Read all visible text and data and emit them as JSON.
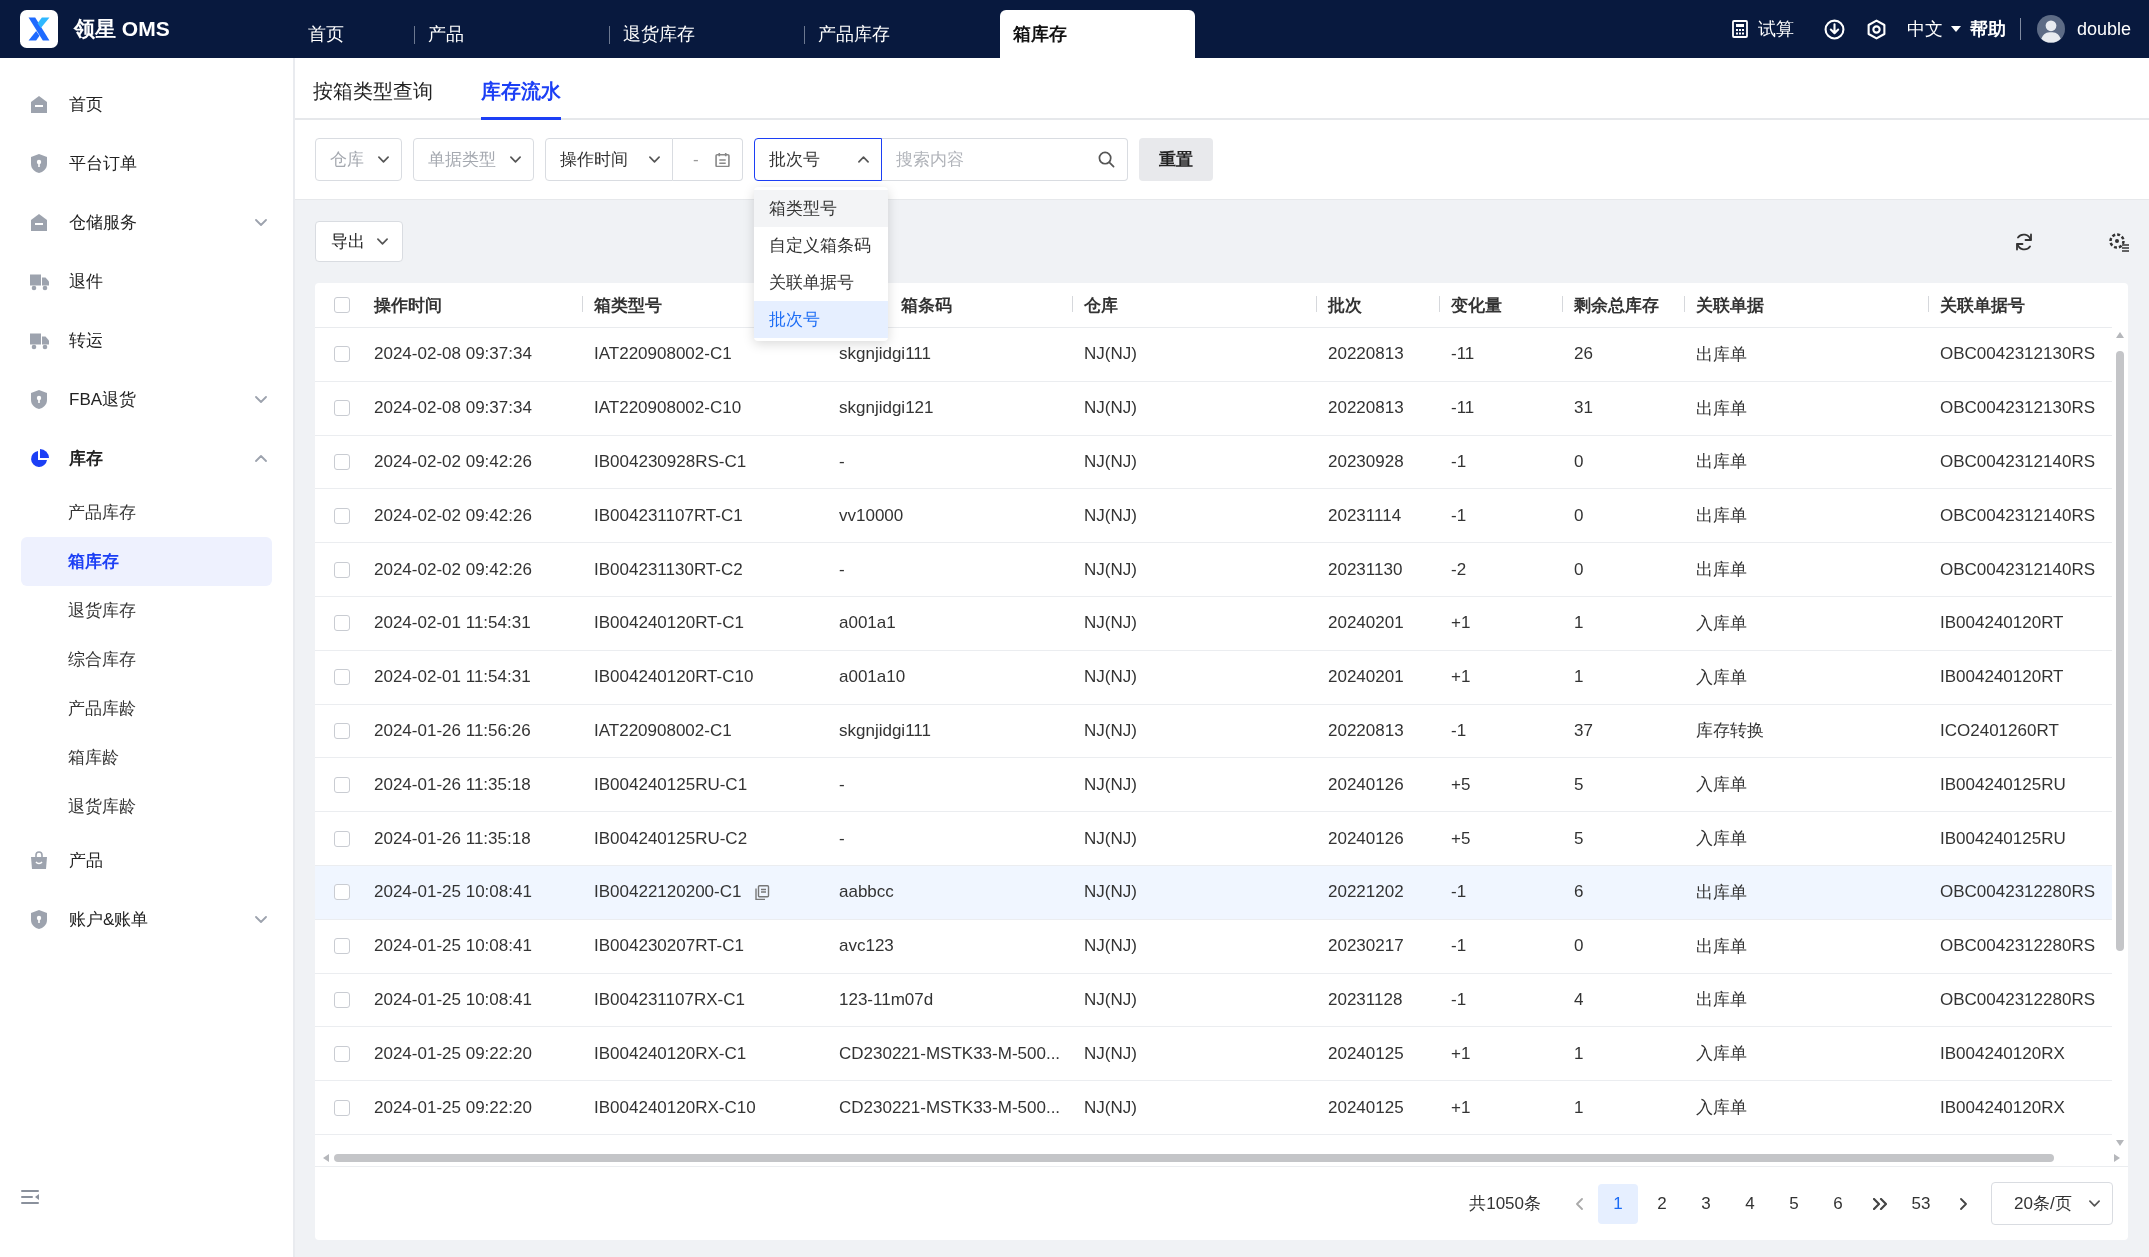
{
  "app": {
    "name": "领星 OMS"
  },
  "top_tabs": [
    {
      "label": "首页",
      "selected": false
    },
    {
      "label": "产品",
      "selected": false
    },
    {
      "label": "退货库存",
      "selected": false
    },
    {
      "label": "产品库存",
      "selected": false
    },
    {
      "label": "箱库存",
      "selected": true
    }
  ],
  "top_actions": {
    "calculator": "试算",
    "language": "中文",
    "help": "帮助",
    "user": "double"
  },
  "sidebar": {
    "items": [
      {
        "label": "首页"
      },
      {
        "label": "平台订单"
      },
      {
        "label": "仓储服务",
        "expanded": false
      },
      {
        "label": "退件"
      },
      {
        "label": "转运"
      },
      {
        "label": "FBA退货",
        "expanded": false
      },
      {
        "label": "库存",
        "expanded": true,
        "children": [
          {
            "label": "产品库存",
            "selected": false
          },
          {
            "label": "箱库存",
            "selected": true
          },
          {
            "label": "退货库存",
            "selected": false
          },
          {
            "label": "综合库存",
            "selected": false
          },
          {
            "label": "产品库龄",
            "selected": false
          },
          {
            "label": "箱库龄",
            "selected": false
          },
          {
            "label": "退货库龄",
            "selected": false
          }
        ]
      },
      {
        "label": "产品"
      },
      {
        "label": "账户&账单",
        "expanded": false
      }
    ]
  },
  "sub_tabs": [
    {
      "label": "按箱类型查询",
      "selected": false
    },
    {
      "label": "库存流水",
      "selected": true
    }
  ],
  "filters": [
    {
      "kind": "select",
      "placeholder": "仓库"
    },
    {
      "kind": "select",
      "placeholder": "单据类型"
    },
    {
      "kind": "select",
      "value": "操作时间",
      "open": false
    },
    {
      "kind": "date-range",
      "separator": "-"
    },
    {
      "kind": "select",
      "value": "批次号",
      "open": true,
      "menu": [
        {
          "label": "箱类型号",
          "selected": false,
          "hovered": true
        },
        {
          "label": "自定义箱条码",
          "selected": false,
          "hovered": false
        },
        {
          "label": "关联单据号",
          "selected": false,
          "hovered": false
        },
        {
          "label": "批次号",
          "selected": true,
          "hovered": false
        }
      ]
    },
    {
      "kind": "search",
      "placeholder": "搜索内容"
    }
  ],
  "reset_button": "重置",
  "export_button": "导出",
  "table": {
    "select_all_checked": false,
    "columns": [
      "操作时间",
      "箱类型号",
      "箱条码",
      "仓库",
      "批次",
      "变化量",
      "剩余总库存",
      "关联单据",
      "关联单据号"
    ],
    "rows": [
      {
        "checked": false,
        "highlighted": false,
        "copy_icon": false,
        "cells": [
          "2024-02-08 09:37:34",
          "IAT220908002-C1",
          "skgnjidgi111",
          "NJ(NJ)",
          "20220813",
          "-11",
          "26",
          "出库单",
          "OBC0042312130RS"
        ]
      },
      {
        "checked": false,
        "highlighted": false,
        "copy_icon": false,
        "cells": [
          "2024-02-08 09:37:34",
          "IAT220908002-C10",
          "skgnjidgi121",
          "NJ(NJ)",
          "20220813",
          "-11",
          "31",
          "出库单",
          "OBC0042312130RS"
        ]
      },
      {
        "checked": false,
        "highlighted": false,
        "copy_icon": false,
        "cells": [
          "2024-02-02 09:42:26",
          "IB004230928RS-C1",
          "-",
          "NJ(NJ)",
          "20230928",
          "-1",
          "0",
          "出库单",
          "OBC0042312140RS"
        ]
      },
      {
        "checked": false,
        "highlighted": false,
        "copy_icon": false,
        "cells": [
          "2024-02-02 09:42:26",
          "IB004231107RT-C1",
          "vv10000",
          "NJ(NJ)",
          "20231114",
          "-1",
          "0",
          "出库单",
          "OBC0042312140RS"
        ]
      },
      {
        "checked": false,
        "highlighted": false,
        "copy_icon": false,
        "cells": [
          "2024-02-02 09:42:26",
          "IB004231130RT-C2",
          "-",
          "NJ(NJ)",
          "20231130",
          "-2",
          "0",
          "出库单",
          "OBC0042312140RS"
        ]
      },
      {
        "checked": false,
        "highlighted": false,
        "copy_icon": false,
        "cells": [
          "2024-02-01 11:54:31",
          "IB004240120RT-C1",
          "a001a1",
          "NJ(NJ)",
          "20240201",
          "+1",
          "1",
          "入库单",
          "IB004240120RT"
        ]
      },
      {
        "checked": false,
        "highlighted": false,
        "copy_icon": false,
        "cells": [
          "2024-02-01 11:54:31",
          "IB004240120RT-C10",
          "a001a10",
          "NJ(NJ)",
          "20240201",
          "+1",
          "1",
          "入库单",
          "IB004240120RT"
        ]
      },
      {
        "checked": false,
        "highlighted": false,
        "copy_icon": false,
        "cells": [
          "2024-01-26 11:56:26",
          "IAT220908002-C1",
          "skgnjidgi111",
          "NJ(NJ)",
          "20220813",
          "-1",
          "37",
          "库存转换",
          "ICO2401260RT"
        ]
      },
      {
        "checked": false,
        "highlighted": false,
        "copy_icon": false,
        "cells": [
          "2024-01-26 11:35:18",
          "IB004240125RU-C1",
          "-",
          "NJ(NJ)",
          "20240126",
          "+5",
          "5",
          "入库单",
          "IB004240125RU"
        ]
      },
      {
        "checked": false,
        "highlighted": false,
        "copy_icon": false,
        "cells": [
          "2024-01-26 11:35:18",
          "IB004240125RU-C2",
          "-",
          "NJ(NJ)",
          "20240126",
          "+5",
          "5",
          "入库单",
          "IB004240125RU"
        ]
      },
      {
        "checked": false,
        "highlighted": true,
        "copy_icon": true,
        "cells": [
          "2024-01-25 10:08:41",
          "IB00422120200-C1",
          "aabbcc",
          "NJ(NJ)",
          "20221202",
          "-1",
          "6",
          "出库单",
          "OBC0042312280RS"
        ]
      },
      {
        "checked": false,
        "highlighted": false,
        "copy_icon": false,
        "cells": [
          "2024-01-25 10:08:41",
          "IB004230207RT-C1",
          "avc123",
          "NJ(NJ)",
          "20230217",
          "-1",
          "0",
          "出库单",
          "OBC0042312280RS"
        ]
      },
      {
        "checked": false,
        "highlighted": false,
        "copy_icon": false,
        "cells": [
          "2024-01-25 10:08:41",
          "IB004231107RX-C1",
          "123-11m07d",
          "NJ(NJ)",
          "20231128",
          "-1",
          "4",
          "出库单",
          "OBC0042312280RS"
        ]
      },
      {
        "checked": false,
        "highlighted": false,
        "copy_icon": false,
        "cells": [
          "2024-01-25 09:22:20",
          "IB004240120RX-C1",
          "CD230221-MSTK33-M-500...",
          "NJ(NJ)",
          "20240125",
          "+1",
          "1",
          "入库单",
          "IB004240120RX"
        ]
      },
      {
        "checked": false,
        "highlighted": false,
        "copy_icon": false,
        "cells": [
          "2024-01-25 09:22:20",
          "IB004240120RX-C10",
          "CD230221-MSTK33-M-500...",
          "NJ(NJ)",
          "20240125",
          "+1",
          "1",
          "入库单",
          "IB004240120RX"
        ]
      }
    ]
  },
  "pagination": {
    "total": "共1050条",
    "pages": [
      {
        "label": "1",
        "selected": true
      },
      {
        "label": "2",
        "selected": false
      },
      {
        "label": "3",
        "selected": false
      },
      {
        "label": "4",
        "selected": false
      },
      {
        "label": "5",
        "selected": false
      },
      {
        "label": "6",
        "selected": false
      }
    ],
    "last_page": "53",
    "page_size": "20条/页"
  }
}
